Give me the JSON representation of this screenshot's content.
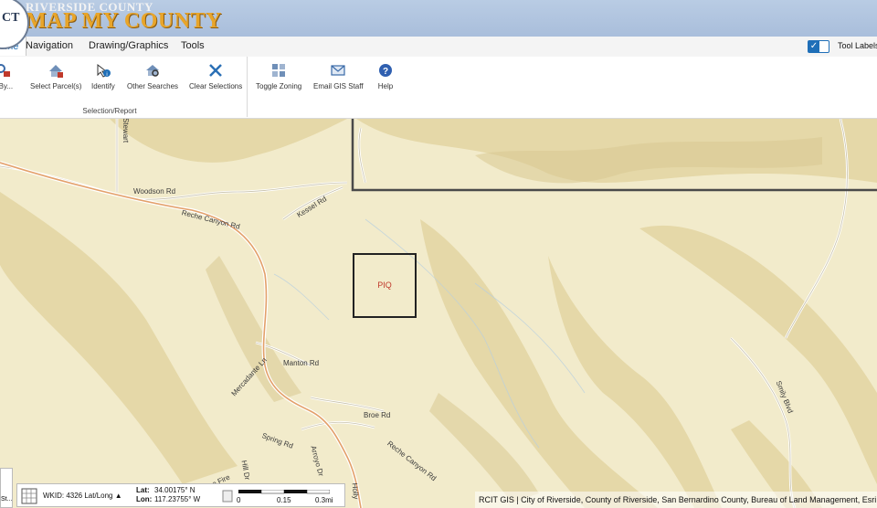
{
  "header": {
    "logo_text": "CT",
    "county": "RIVERSIDE COUNTY",
    "title": "MAP MY COUNTY"
  },
  "tabs": [
    {
      "label": "ome",
      "active": true
    },
    {
      "label": "Navigation"
    },
    {
      "label": "Drawing/Graphics"
    },
    {
      "label": "Tools"
    }
  ],
  "tool_labels": {
    "label": "Tool Labels",
    "checked": true
  },
  "ribbon": {
    "group_title": "Selection/Report",
    "buttons": [
      {
        "label": "h By...",
        "icon": "search-by-icon"
      },
      {
        "label": "Select Parcel(s)",
        "icon": "select-parcel-icon"
      },
      {
        "label": "Identify",
        "icon": "identify-icon"
      },
      {
        "label": "Other Searches",
        "icon": "other-searches-icon"
      },
      {
        "label": "Clear Selections",
        "icon": "clear-x-icon"
      },
      {
        "label": "Toggle Zoning",
        "icon": "grid-icon"
      },
      {
        "label": "Email GIS Staff",
        "icon": "email-icon"
      },
      {
        "label": "Help",
        "icon": "help-icon"
      }
    ]
  },
  "map": {
    "piq_label": "PIQ",
    "roads": [
      "Stewart",
      "Woodson Rd",
      "Reche Canyon Rd",
      "Kessel Rd",
      "Manton Rd",
      "Mercadante Ln",
      "Broe Rd",
      "Spring Rd",
      "Arroyo Dr",
      "Reche Canyon Rd",
      "Smily Blvd",
      "Hill Dr",
      "Stone Fire",
      "Holly"
    ]
  },
  "status": {
    "left_stub": "St...",
    "wkid": "WKID: 4326 Lat/Long ▲",
    "lat_label": "Lat:",
    "lat_value": "34.00175° N",
    "lon_label": "Lon:",
    "lon_value": "117.23755° W",
    "scale_labels": [
      "0",
      "0.15",
      "0.3mi"
    ]
  },
  "attribution": "RCIT GIS | City of Riverside, County of Riverside, San Bernardino County, Bureau of Land Management, Esri, HERE",
  "colors": {
    "header_bg": "#b0c4df",
    "title_gold": "#e8a52a",
    "accent_blue": "#1f6fb8",
    "map_bg": "#f2ebcb",
    "piq_red": "#c0392b"
  }
}
